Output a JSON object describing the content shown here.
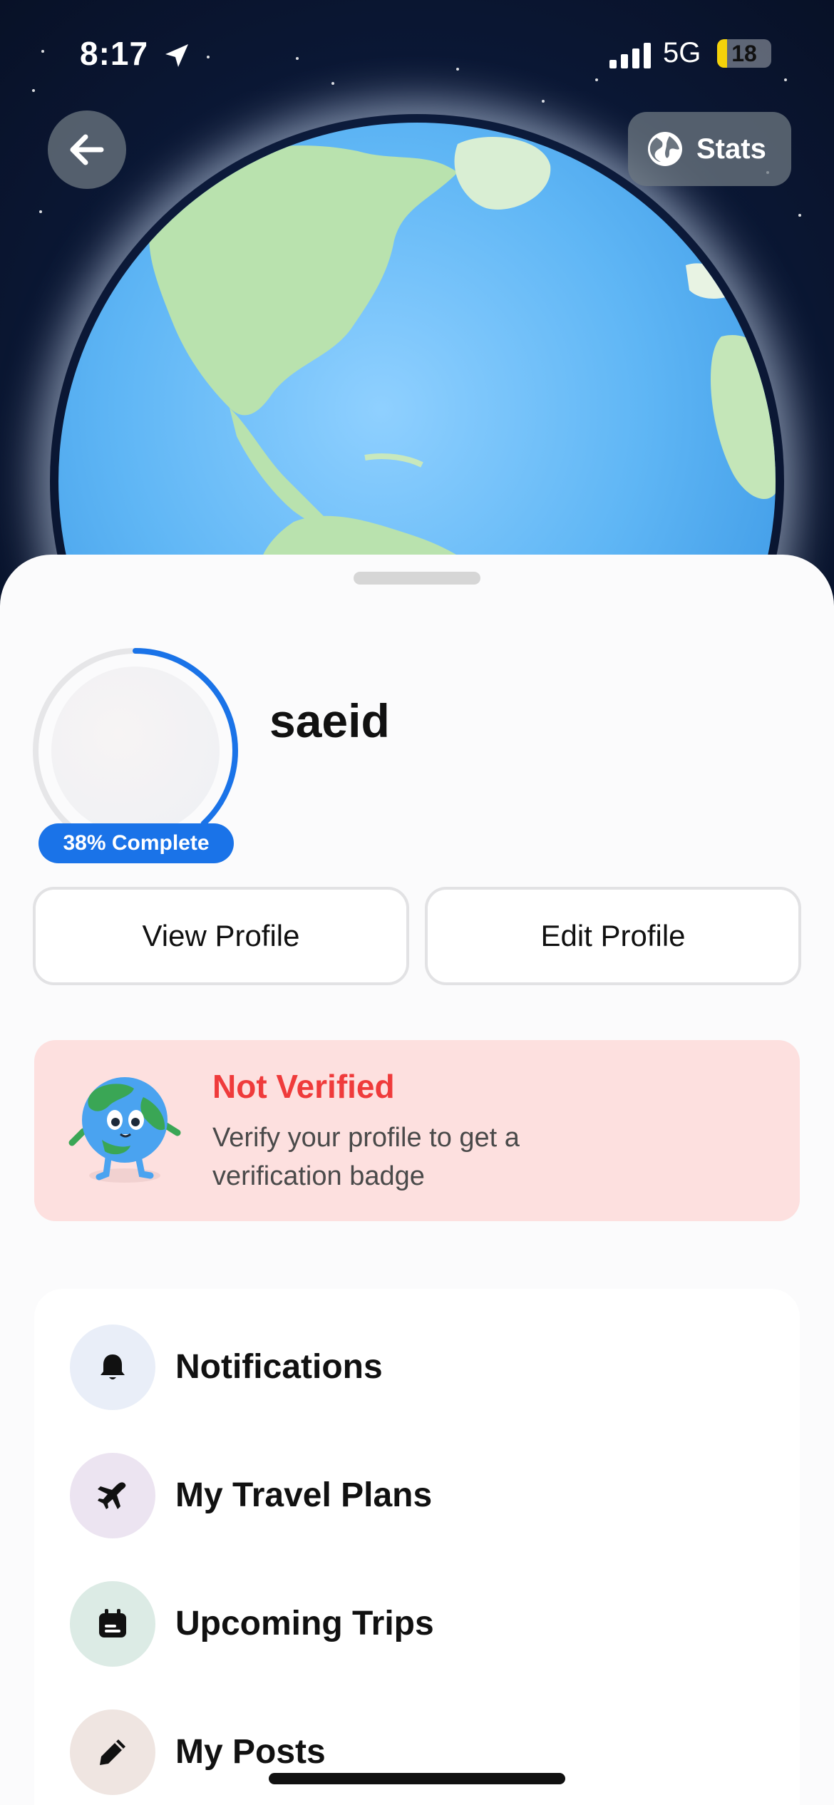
{
  "status_bar": {
    "time": "8:17",
    "network": "5G",
    "battery_level": "18",
    "battery_fraction": 0.18
  },
  "header": {
    "back_icon": "arrow-left-icon",
    "stats_label": "Stats",
    "stats_icon": "globe-icon"
  },
  "profile": {
    "username": "saeid",
    "completion_label": "38% Complete",
    "completion_fraction": 0.38,
    "view_profile_label": "View Profile",
    "edit_profile_label": "Edit Profile"
  },
  "verification": {
    "title": "Not Verified",
    "description": "Verify your profile to get a verification badge",
    "title_color": "#ef3b3b",
    "background_color": "#fde0df"
  },
  "menu": {
    "items": [
      {
        "label": "Notifications",
        "icon": "bell-icon",
        "icon_bg": "#e9eef8"
      },
      {
        "label": "My Travel Plans",
        "icon": "airplane-icon",
        "icon_bg": "#ece4f1"
      },
      {
        "label": "Upcoming Trips",
        "icon": "calendar-icon",
        "icon_bg": "#dcebe5"
      },
      {
        "label": "My Posts",
        "icon": "pencil-icon",
        "icon_bg": "#efe5e1"
      }
    ]
  },
  "colors": {
    "accent": "#1a73e8",
    "space_bg": "#0c1a3a"
  }
}
